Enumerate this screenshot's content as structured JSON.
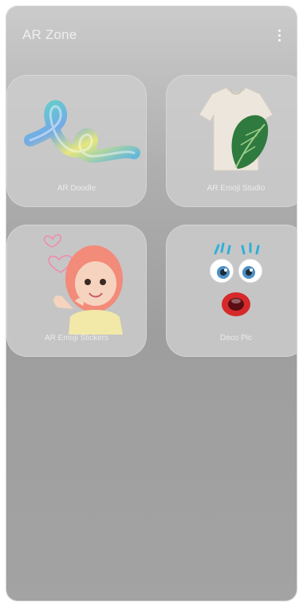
{
  "app": {
    "title": "AR Zone"
  },
  "header": {
    "more_icon": "more-vertical-icon"
  },
  "tiles": [
    {
      "label": "AR Doodle",
      "icon": "ar-doodle-icon"
    },
    {
      "label": "AR Emoji Studio",
      "icon": "t-shirt-icon"
    },
    {
      "label": "AR Emoji Stickers",
      "icon": "emoji-sticker-icon"
    },
    {
      "label": "Deco Pic",
      "icon": "deco-pic-icon"
    }
  ],
  "colors": {
    "background_top": "#cbcbcb",
    "background_bottom": "#a3a3a3",
    "tile": "#cdcdcd"
  }
}
